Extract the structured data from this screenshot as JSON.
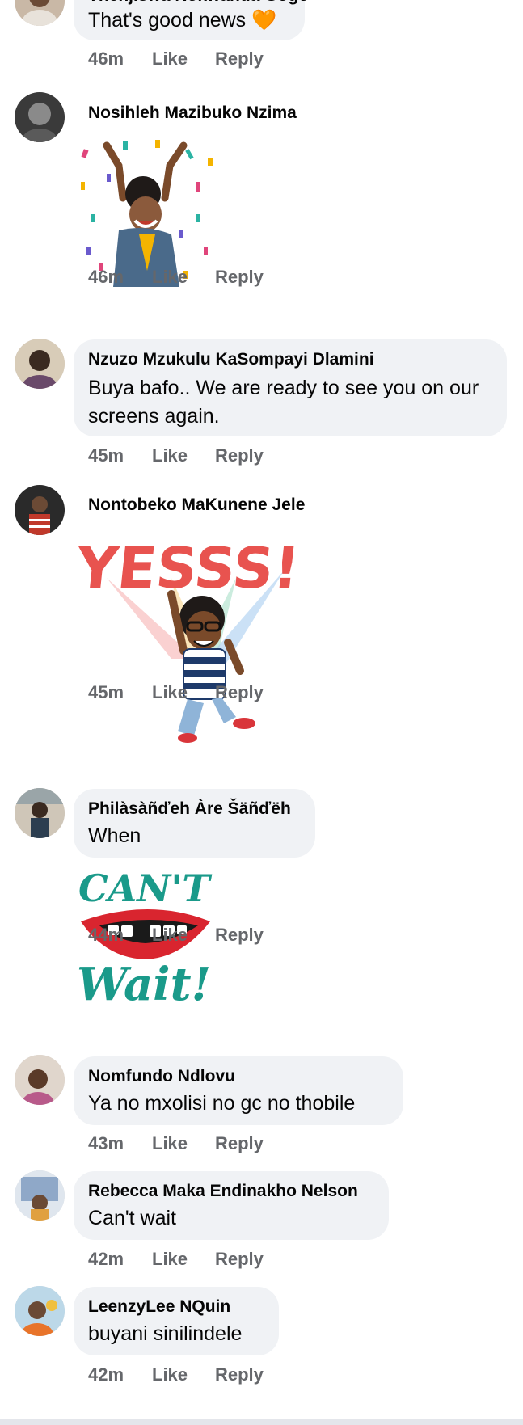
{
  "comments": [
    {
      "name": "Thenjiswa Nokwanda Gogo",
      "text": "That's good news",
      "emoji": "🧡",
      "time": "46m",
      "like": "Like",
      "reply": "Reply"
    },
    {
      "name": "Nosihleh Mazibuko Nzima",
      "sticker": "celebration-confetti-sticker",
      "time": "46m",
      "like": "Like",
      "reply": "Reply"
    },
    {
      "name": "Nzuzo Mzukulu KaSompayi Dlamini",
      "text": "Buya bafo.. We are ready to see you on our screens again.",
      "time": "45m",
      "like": "Like",
      "reply": "Reply"
    },
    {
      "name": "Nontobeko MaKunene Jele",
      "sticker": "yesss-jumping-sticker",
      "sticker_text": "YESSS!",
      "time": "45m",
      "like": "Like",
      "reply": "Reply"
    },
    {
      "name": "Philàsàñďeh Àre Šäñďëh",
      "text": "When",
      "sticker": "cant-wait-lips-sticker",
      "sticker_text_top": "CAN'T",
      "sticker_text_bottom": "Wait!",
      "time": "44m",
      "like": "Like",
      "reply": "Reply"
    },
    {
      "name": "Nomfundo Ndlovu",
      "text": "Ya no mxolisi no gc no thobile",
      "time": "43m",
      "like": "Like",
      "reply": "Reply"
    },
    {
      "name": "Rebecca Maka Endinakho Nelson",
      "text": "Can't wait",
      "time": "42m",
      "like": "Like",
      "reply": "Reply"
    },
    {
      "name": "LeenzyLee NQuin",
      "text": "buyani sinilindele",
      "time": "42m",
      "like": "Like",
      "reply": "Reply"
    }
  ],
  "colors": {
    "bubble": "#f0f2f5",
    "meta": "#65676b",
    "text": "#050505"
  }
}
